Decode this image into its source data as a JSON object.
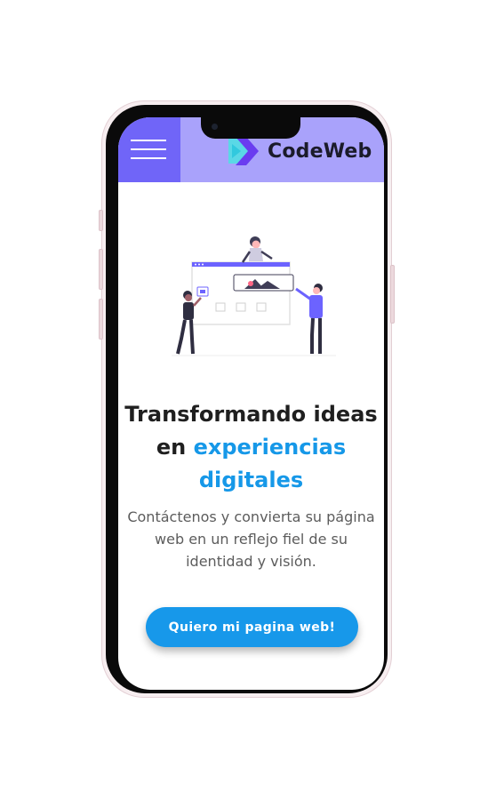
{
  "header": {
    "brand": "CodeWeb",
    "menu_icon": "hamburger-menu-icon",
    "logo_icon": "codeweb-logo-icon"
  },
  "hero": {
    "illustration": "web-team-illustration",
    "title_part1": "Transformando ideas",
    "title_part2": "en",
    "title_accent": "experiencias digitales",
    "subtitle": "Contáctenos y convierta su página web en un reflejo fiel de su identidad y visión.",
    "cta_label": "Quiero mi pagina web!"
  },
  "colors": {
    "header_bg": "#a9a2fb",
    "menu_bg": "#7065f8",
    "accent": "#1698e8",
    "button_bg": "#1798ea",
    "title_text": "#1f1f1f",
    "body_text": "#5c5c5c"
  }
}
